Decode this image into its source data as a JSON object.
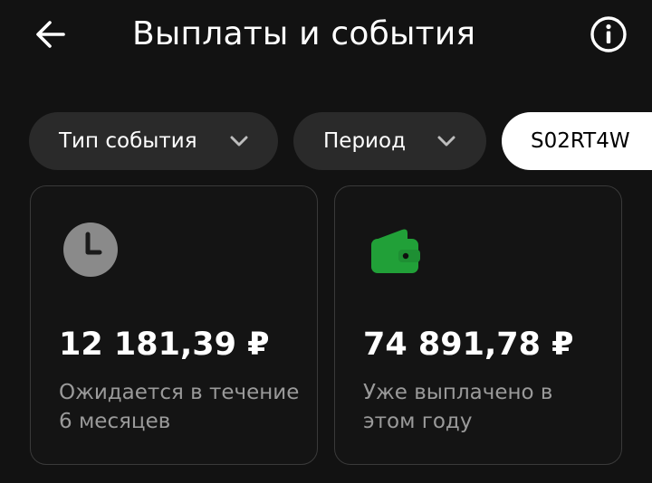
{
  "header": {
    "title": "Выплаты и события",
    "back_icon": "arrow-left-icon",
    "info_icon": "info-circle-icon"
  },
  "filters": {
    "event_type": {
      "label": "Тип события",
      "icon": "chevron-down-icon"
    },
    "period": {
      "label": "Период",
      "icon": "chevron-down-icon"
    },
    "account": {
      "label": "S02RT4W",
      "selected": true
    }
  },
  "cards": {
    "pending": {
      "icon": "clock-icon",
      "amount": "12 181,39 ₽",
      "caption": "Ожидается в течение 6 месяцев"
    },
    "paid": {
      "icon": "wallet-icon",
      "amount": "74 891,78 ₽",
      "caption": "Уже выплачено в этом году"
    }
  },
  "colors": {
    "background": "#121212",
    "chip": "#2a2a2a",
    "chip_selected": "#ffffff",
    "clock_icon": "#8a8a8a",
    "wallet_icon": "#21a038",
    "caption": "#9a9a9a",
    "card_border": "#3a3a3a"
  }
}
